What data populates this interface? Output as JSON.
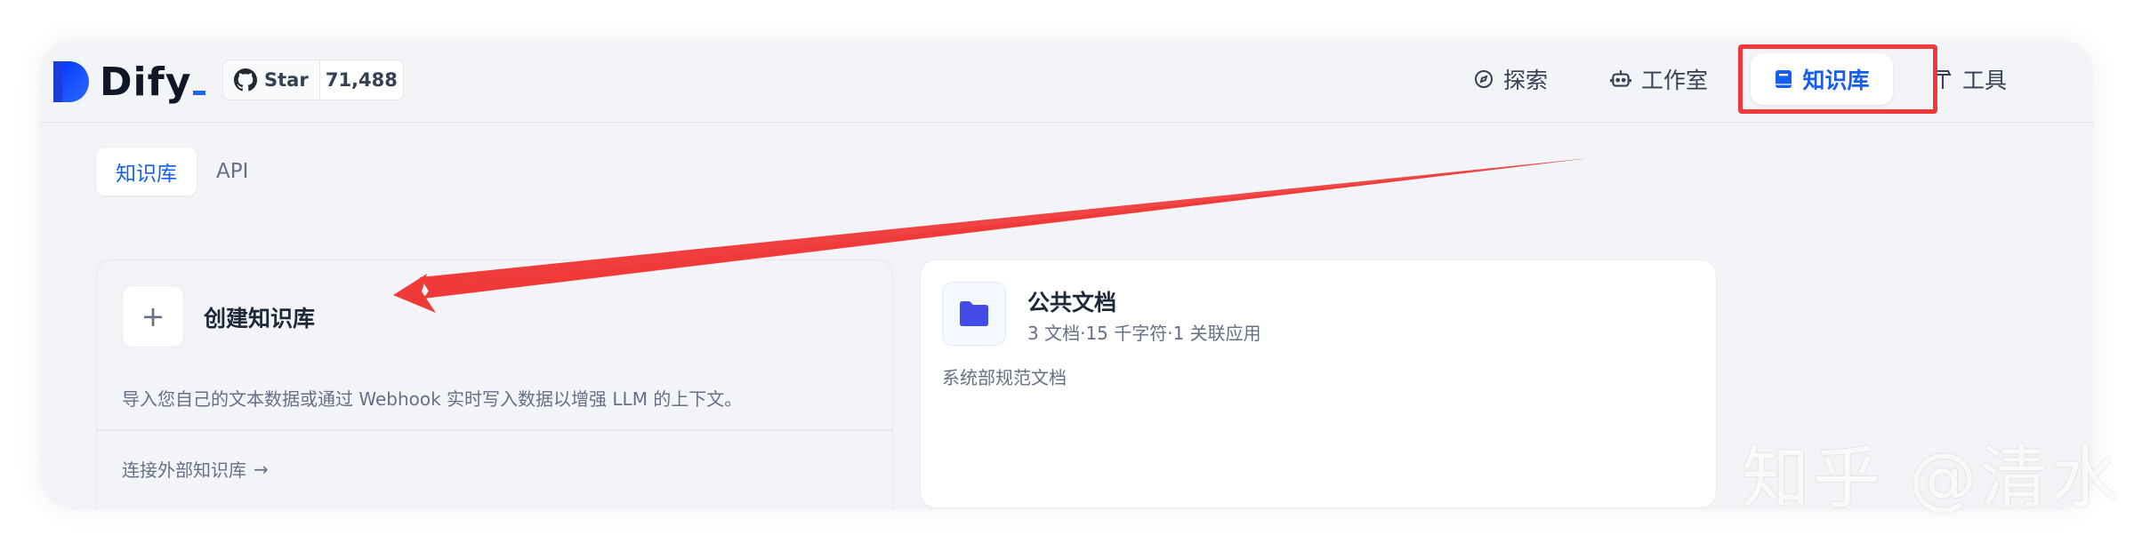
{
  "brand": {
    "name": "Dify"
  },
  "github": {
    "label": "Star",
    "count": "71,488"
  },
  "nav": {
    "explore": "探索",
    "studio": "工作室",
    "datasets": "知识库",
    "tools": "工具"
  },
  "tabs": {
    "datasets": "知识库",
    "api": "API"
  },
  "create_card": {
    "plus": "+",
    "title": "创建知识库",
    "description": "导入您自己的文本数据或通过 Webhook 实时写入数据以增强 LLM 的上下文。",
    "external_link": "连接外部知识库",
    "arrow": "→"
  },
  "dataset_card": {
    "name": "公共文档",
    "meta": "3 文档·15 千字符·1 关联应用",
    "description": "系统部规范文档"
  },
  "watermark": "知乎 @清水",
  "colors": {
    "accent": "#155eef",
    "annotation_red": "#f03a3a",
    "background": "#f2f4f7"
  }
}
